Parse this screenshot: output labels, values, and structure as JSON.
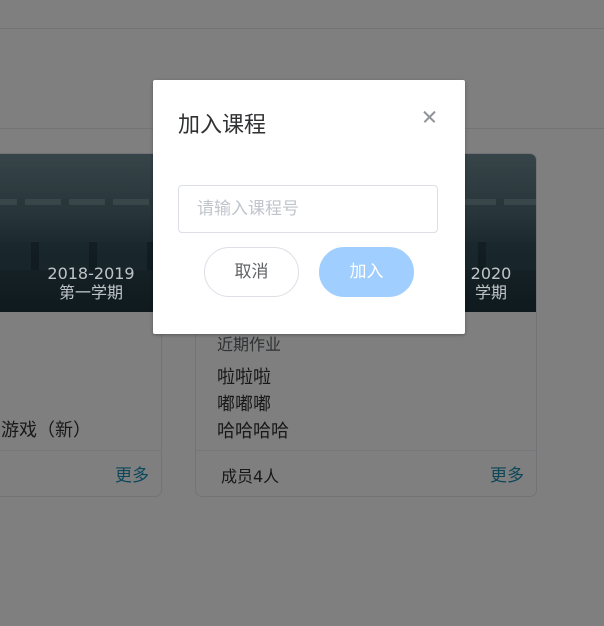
{
  "background": {
    "card_left": {
      "banner_year": "2018-2019",
      "banner_term": "第一学期",
      "course_text": "游戏（新）",
      "more_label": "更多"
    },
    "card_right": {
      "banner_year": "2020",
      "banner_term": "学期",
      "work_title": "近期作业",
      "work_items": [
        "啦啦啦",
        "嘟嘟嘟",
        "哈哈哈哈"
      ],
      "members": "成员4人",
      "more_label": "更多"
    }
  },
  "dialog": {
    "title": "加入课程",
    "close_icon": "close-icon",
    "input_value": "",
    "input_placeholder": "请输入课程号",
    "cancel_label": "取消",
    "join_label": "加入",
    "join_color": "#a0cfff"
  },
  "colors": {
    "link": "#1a8fb5",
    "overlay": "rgba(0,0,0,0.5)"
  }
}
